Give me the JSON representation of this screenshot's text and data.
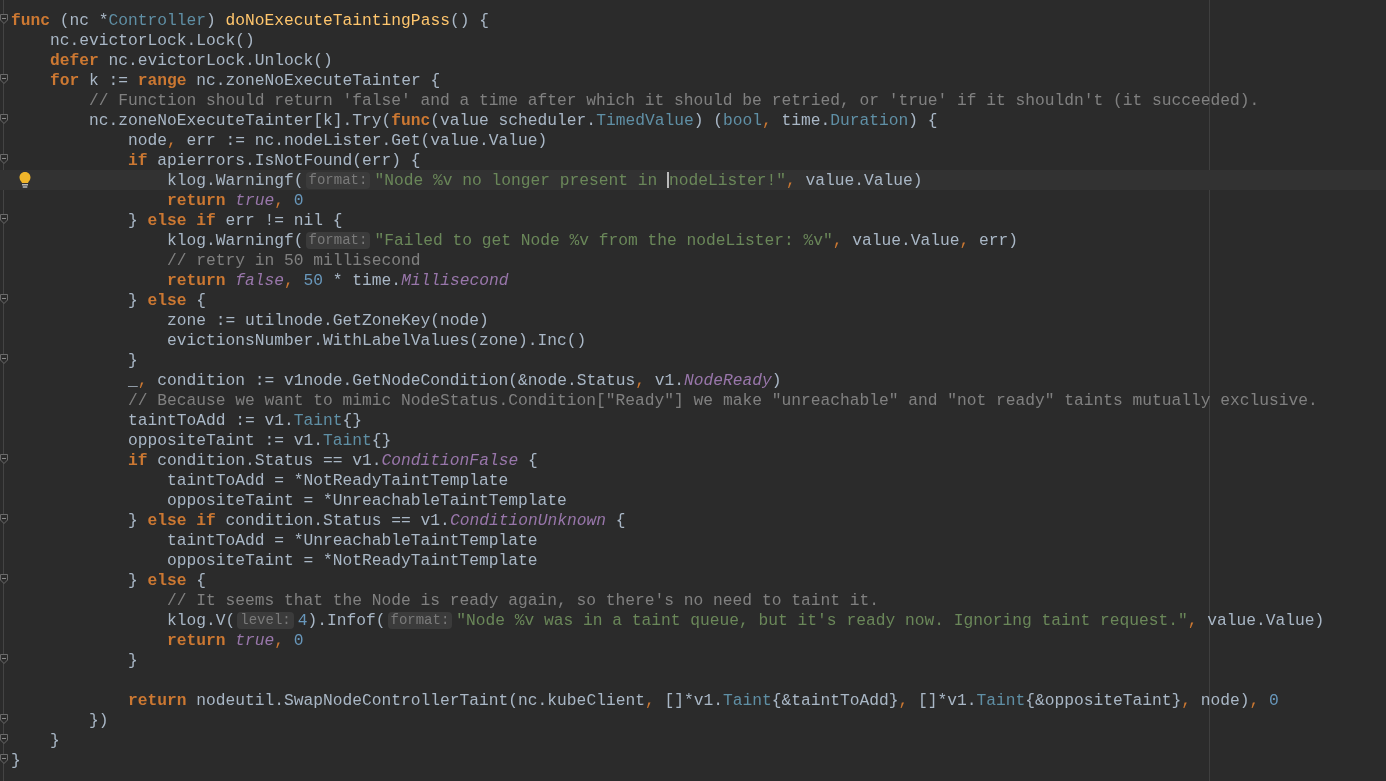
{
  "editor": {
    "lines": [
      {
        "fold": true,
        "tokens": [
          {
            "kind": "keyword",
            "text": "func"
          },
          {
            "kind": "plain",
            "text": " (nc *"
          },
          {
            "kind": "type",
            "text": "Controller"
          },
          {
            "kind": "plain",
            "text": ") "
          },
          {
            "kind": "declaration",
            "text": "doNoExecuteTaintingPass"
          },
          {
            "kind": "plain",
            "text": "() {"
          }
        ]
      },
      {
        "tokens": [
          {
            "kind": "plain",
            "text": "    nc.evictorLock.Lock()"
          }
        ]
      },
      {
        "tokens": [
          {
            "kind": "keyword",
            "text": "    defer"
          },
          {
            "kind": "plain",
            "text": " nc.evictorLock.Unlock()"
          }
        ]
      },
      {
        "fold": true,
        "tokens": [
          {
            "kind": "keyword",
            "text": "    for"
          },
          {
            "kind": "plain",
            "text": " k := "
          },
          {
            "kind": "keyword",
            "text": "range"
          },
          {
            "kind": "plain",
            "text": " nc.zoneNoExecuteTainter {"
          }
        ]
      },
      {
        "tokens": [
          {
            "kind": "comment",
            "text": "        // Function should return 'false' and a time after which it should be retried, or 'true' if it shouldn't (it succeeded)."
          }
        ]
      },
      {
        "fold": true,
        "tokens": [
          {
            "kind": "plain",
            "text": "        nc.zoneNoExecuteTainter[k].Try("
          },
          {
            "kind": "keyword",
            "text": "func"
          },
          {
            "kind": "plain",
            "text": "(value scheduler."
          },
          {
            "kind": "type",
            "text": "TimedValue"
          },
          {
            "kind": "plain",
            "text": ") ("
          },
          {
            "kind": "type",
            "text": "bool"
          },
          {
            "kind": "punct",
            "text": ", "
          },
          {
            "kind": "plain",
            "text": "time."
          },
          {
            "kind": "type",
            "text": "Duration"
          },
          {
            "kind": "plain",
            "text": ") {"
          }
        ]
      },
      {
        "tokens": [
          {
            "kind": "plain",
            "text": "            node"
          },
          {
            "kind": "punct",
            "text": ", "
          },
          {
            "kind": "plain",
            "text": "err := nc.nodeLister.Get(value.Value)"
          }
        ]
      },
      {
        "fold": true,
        "tokens": [
          {
            "kind": "keyword",
            "text": "            if"
          },
          {
            "kind": "plain",
            "text": " apierrors.IsNotFound(err) {"
          }
        ]
      },
      {
        "current": true,
        "bulb": true,
        "tokens": [
          {
            "kind": "plain",
            "text": "                klog.Warningf("
          },
          {
            "kind": "hint",
            "text": "format:"
          },
          {
            "kind": "string",
            "text": "\"Node %v no longer present in "
          },
          {
            "kind": "caret"
          },
          {
            "kind": "string",
            "text": "nodeLister!\""
          },
          {
            "kind": "punct",
            "text": ", "
          },
          {
            "kind": "plain",
            "text": "value.Value)"
          }
        ]
      },
      {
        "tokens": [
          {
            "kind": "keyword",
            "text": "                return "
          },
          {
            "kind": "constant",
            "text": "true"
          },
          {
            "kind": "punct",
            "text": ", "
          },
          {
            "kind": "number",
            "text": "0"
          }
        ]
      },
      {
        "fold": true,
        "tokens": [
          {
            "kind": "plain",
            "text": "            } "
          },
          {
            "kind": "keyword",
            "text": "else if"
          },
          {
            "kind": "plain",
            "text": " err != nil {"
          }
        ]
      },
      {
        "tokens": [
          {
            "kind": "plain",
            "text": "                klog.Warningf("
          },
          {
            "kind": "hint",
            "text": "format:"
          },
          {
            "kind": "string",
            "text": "\"Failed to get Node %v from the nodeLister: %v\""
          },
          {
            "kind": "punct",
            "text": ", "
          },
          {
            "kind": "plain",
            "text": "value.Value"
          },
          {
            "kind": "punct",
            "text": ", "
          },
          {
            "kind": "plain",
            "text": "err)"
          }
        ]
      },
      {
        "tokens": [
          {
            "kind": "comment",
            "text": "                // retry in 50 millisecond"
          }
        ]
      },
      {
        "tokens": [
          {
            "kind": "keyword",
            "text": "                return "
          },
          {
            "kind": "constant",
            "text": "false"
          },
          {
            "kind": "punct",
            "text": ", "
          },
          {
            "kind": "number",
            "text": "50"
          },
          {
            "kind": "plain",
            "text": " * time."
          },
          {
            "kind": "constant",
            "text": "Millisecond"
          }
        ]
      },
      {
        "fold": true,
        "tokens": [
          {
            "kind": "plain",
            "text": "            } "
          },
          {
            "kind": "keyword",
            "text": "else"
          },
          {
            "kind": "plain",
            "text": " {"
          }
        ]
      },
      {
        "tokens": [
          {
            "kind": "plain",
            "text": "                zone := utilnode.GetZoneKey(node)"
          }
        ]
      },
      {
        "tokens": [
          {
            "kind": "plain",
            "text": "                evictionsNumber.WithLabelValues(zone).Inc()"
          }
        ]
      },
      {
        "fold": true,
        "tokens": [
          {
            "kind": "plain",
            "text": "            }"
          }
        ]
      },
      {
        "tokens": [
          {
            "kind": "plain",
            "text": "            _"
          },
          {
            "kind": "punct",
            "text": ", "
          },
          {
            "kind": "plain",
            "text": "condition := v1node.GetNodeCondition(&node.Status"
          },
          {
            "kind": "punct",
            "text": ", "
          },
          {
            "kind": "plain",
            "text": "v1."
          },
          {
            "kind": "constant",
            "text": "NodeReady"
          },
          {
            "kind": "plain",
            "text": ")"
          }
        ]
      },
      {
        "tokens": [
          {
            "kind": "comment",
            "text": "            // Because we want to mimic NodeStatus.Condition[\"Ready\"] we make \"unreachable\" and \"not ready\" taints mutually exclusive."
          }
        ]
      },
      {
        "tokens": [
          {
            "kind": "plain",
            "text": "            taintToAdd := v1."
          },
          {
            "kind": "type",
            "text": "Taint"
          },
          {
            "kind": "plain",
            "text": "{}"
          }
        ]
      },
      {
        "tokens": [
          {
            "kind": "plain",
            "text": "            oppositeTaint := v1."
          },
          {
            "kind": "type",
            "text": "Taint"
          },
          {
            "kind": "plain",
            "text": "{}"
          }
        ]
      },
      {
        "fold": true,
        "tokens": [
          {
            "kind": "keyword",
            "text": "            if"
          },
          {
            "kind": "plain",
            "text": " condition.Status == v1."
          },
          {
            "kind": "constant",
            "text": "ConditionFalse"
          },
          {
            "kind": "plain",
            "text": " {"
          }
        ]
      },
      {
        "tokens": [
          {
            "kind": "plain",
            "text": "                taintToAdd = *NotReadyTaintTemplate"
          }
        ]
      },
      {
        "tokens": [
          {
            "kind": "plain",
            "text": "                oppositeTaint = *UnreachableTaintTemplate"
          }
        ]
      },
      {
        "fold": true,
        "tokens": [
          {
            "kind": "plain",
            "text": "            } "
          },
          {
            "kind": "keyword",
            "text": "else if"
          },
          {
            "kind": "plain",
            "text": " condition.Status == v1."
          },
          {
            "kind": "constant",
            "text": "ConditionUnknown"
          },
          {
            "kind": "plain",
            "text": " {"
          }
        ]
      },
      {
        "tokens": [
          {
            "kind": "plain",
            "text": "                taintToAdd = *UnreachableTaintTemplate"
          }
        ]
      },
      {
        "tokens": [
          {
            "kind": "plain",
            "text": "                oppositeTaint = *NotReadyTaintTemplate"
          }
        ]
      },
      {
        "fold": true,
        "tokens": [
          {
            "kind": "plain",
            "text": "            } "
          },
          {
            "kind": "keyword",
            "text": "else"
          },
          {
            "kind": "plain",
            "text": " {"
          }
        ]
      },
      {
        "tokens": [
          {
            "kind": "comment",
            "text": "                // It seems that the Node is ready again, so there's no need to taint it."
          }
        ]
      },
      {
        "tokens": [
          {
            "kind": "plain",
            "text": "                klog.V("
          },
          {
            "kind": "hint",
            "text": "level:"
          },
          {
            "kind": "number",
            "text": "4"
          },
          {
            "kind": "plain",
            "text": ").Infof("
          },
          {
            "kind": "hint",
            "text": "format:"
          },
          {
            "kind": "string",
            "text": "\"Node %v was in a taint queue, but it's ready now. Ignoring taint request.\""
          },
          {
            "kind": "punct",
            "text": ", "
          },
          {
            "kind": "plain",
            "text": "value.Value)"
          }
        ]
      },
      {
        "tokens": [
          {
            "kind": "keyword",
            "text": "                return "
          },
          {
            "kind": "constant",
            "text": "true"
          },
          {
            "kind": "punct",
            "text": ", "
          },
          {
            "kind": "number",
            "text": "0"
          }
        ]
      },
      {
        "fold": true,
        "blank_after": true,
        "tokens": [
          {
            "kind": "plain",
            "text": "            }"
          }
        ]
      },
      {
        "tokens": [
          {
            "kind": "keyword",
            "text": "            return"
          },
          {
            "kind": "plain",
            "text": " nodeutil.SwapNodeControllerTaint(nc.kubeClient"
          },
          {
            "kind": "punct",
            "text": ", "
          },
          {
            "kind": "plain",
            "text": "[]*v1."
          },
          {
            "kind": "type",
            "text": "Taint"
          },
          {
            "kind": "plain",
            "text": "{&taintToAdd}"
          },
          {
            "kind": "punct",
            "text": ", "
          },
          {
            "kind": "plain",
            "text": "[]*v1."
          },
          {
            "kind": "type",
            "text": "Taint"
          },
          {
            "kind": "plain",
            "text": "{&oppositeTaint}"
          },
          {
            "kind": "punct",
            "text": ", "
          },
          {
            "kind": "plain",
            "text": "node)"
          },
          {
            "kind": "punct",
            "text": ", "
          },
          {
            "kind": "number",
            "text": "0"
          }
        ]
      },
      {
        "fold": true,
        "tokens": [
          {
            "kind": "plain",
            "text": "        })"
          }
        ]
      },
      {
        "fold": true,
        "tokens": [
          {
            "kind": "plain",
            "text": "    }"
          }
        ]
      },
      {
        "fold": true,
        "tokens": [
          {
            "kind": "plain",
            "text": "}"
          }
        ]
      }
    ]
  }
}
